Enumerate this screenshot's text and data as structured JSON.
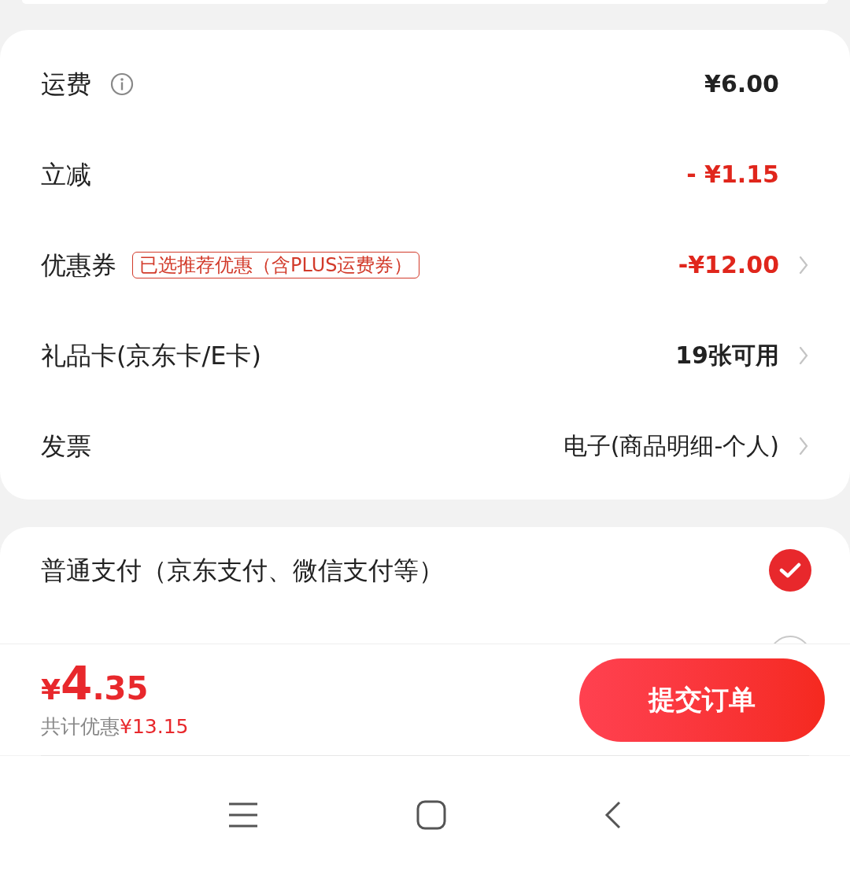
{
  "fee_rows": [
    {
      "kind": "info",
      "label": "运费",
      "value": "¥6.00",
      "highlight": false,
      "chevron": false
    },
    {
      "kind": "plain",
      "label": "立减",
      "value": "- ¥1.15",
      "highlight": true,
      "chevron": false
    },
    {
      "kind": "tag",
      "label": "优惠券",
      "tag": "已选推荐优惠（含PLUS运费券）",
      "value": "-¥12.00",
      "highlight": true,
      "chevron": true
    },
    {
      "kind": "plain",
      "label": "礼品卡(京东卡/E卡)",
      "value": "19张可用",
      "highlight": false,
      "chevron": true
    },
    {
      "kind": "plain",
      "label": "发票",
      "value": "电子(商品明细-个人)",
      "highlight": false,
      "chevron": true
    }
  ],
  "payment_options": [
    {
      "label": "普通支付（京东支付、微信支付等）",
      "selected": true
    },
    {
      "selected": false
    }
  ],
  "summary": {
    "currency": "¥",
    "price_int": "4",
    "price_dec": ".35",
    "saving_label": "共计优惠",
    "saving_value": "¥13.15"
  },
  "submit_button": "提交订单"
}
